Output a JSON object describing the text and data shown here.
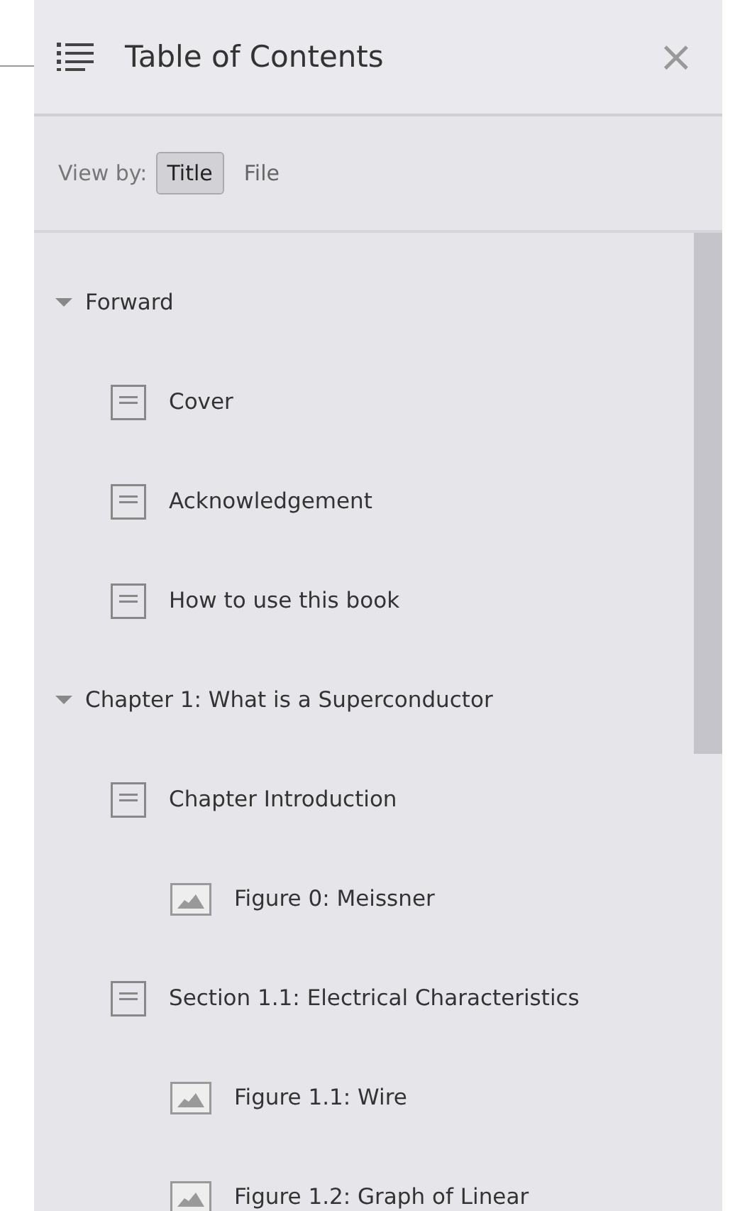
{
  "panel": {
    "title": "Table of Contents",
    "close": "×"
  },
  "view_by": {
    "label": "View by:",
    "options": [
      {
        "label": "Title",
        "selected": true
      },
      {
        "label": "File",
        "selected": false
      }
    ]
  },
  "tree": [
    {
      "kind": "group",
      "label": "Forward",
      "expanded": true,
      "children": [
        {
          "kind": "page",
          "label": "Cover"
        },
        {
          "kind": "page",
          "label": "Acknowledgement"
        },
        {
          "kind": "page",
          "label": "How to use this book"
        }
      ]
    },
    {
      "kind": "group",
      "label": "Chapter 1: What is a Superconductor",
      "expanded": true,
      "children": [
        {
          "kind": "page",
          "label": "Chapter Introduction",
          "children": [
            {
              "kind": "figure",
              "label": "Figure 0: Meissner"
            }
          ]
        },
        {
          "kind": "page",
          "label": "Section 1.1: Electrical Characteristics",
          "children": [
            {
              "kind": "figure",
              "label": "Figure 1.1: Wire"
            },
            {
              "kind": "figure",
              "label": "Figure 1.2: Graph of Linear"
            }
          ]
        }
      ]
    }
  ]
}
